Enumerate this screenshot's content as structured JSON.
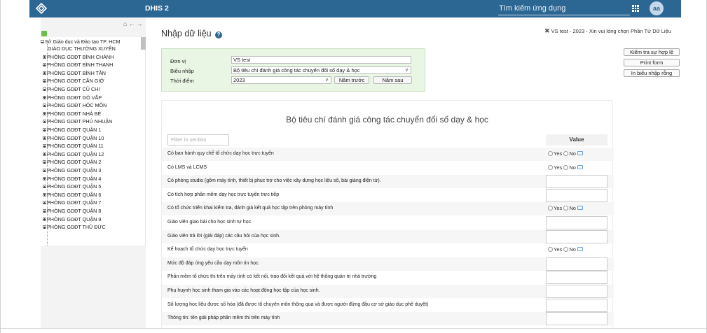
{
  "header": {
    "app_name": "DHIS 2",
    "search_placeholder": "Tìm kiếm ứng dụng",
    "avatar_initials": "aa",
    "bg_color": "#2c6693"
  },
  "tree": {
    "root": "Sở Giáo dục và Đào tạo TP. HCM",
    "items": [
      "GIÁO DỤC THƯỜNG XUYÊN",
      "PHÒNG GDĐT BÌNH CHÁNH",
      "PHÒNG GDĐT BÌNH THẠNH",
      "PHÒNG GDĐT BÌNH TÂN",
      "PHÒNG GDĐT CẦN GIỜ",
      "PHÒNG GDĐT CỦ CHI",
      "PHÒNG GDĐT GÒ VẤP",
      "PHÒNG GDĐT HÓC MÔN",
      "PHÒNG GDĐT NHÀ BÈ",
      "PHÒNG GDĐT PHÚ NHUẬN",
      "PHÒNG GDĐT QUẬN 1",
      "PHÒNG GDĐT QUẬN 10",
      "PHÒNG GDĐT QUẬN 11",
      "PHÒNG GDĐT QUẬN 12",
      "PHÒNG GDĐT QUẬN 2",
      "PHÒNG GDĐT QUẬN 3",
      "PHÒNG GDĐT QUẬN 4",
      "PHÒNG GDĐT QUẬN 5",
      "PHÒNG GDĐT QUẬN 6",
      "PHÒNG GDĐT QUẬN 7",
      "PHÒNG GDĐT QUẬN 8",
      "PHÒNG GDĐT QUẬN 9",
      "PHÒNG GDĐT THỦ ĐỨC"
    ]
  },
  "main": {
    "title": "Nhập dữ liệu",
    "notice": "VS test - 2023 - Xin vui lòng chọn Phần Tử Dữ Liệu",
    "buttons": {
      "validate": "Kiểm tra sự hợp lệ",
      "print_form": "Print form",
      "print_blank": "In biểu nhập rỗng"
    },
    "selection": {
      "org_unit_label": "Đơn vị",
      "org_unit_value": "VS test",
      "dataset_label": "Biểu nhập",
      "dataset_value": "Bộ tiêu chí đánh giá công tác chuyển đổi số dạy & học",
      "period_label": "Thời điểm",
      "period_value": "2023",
      "prev_year": "Năm trước",
      "next_year": "Năm sau"
    },
    "form": {
      "title": "Bộ tiêu chí đánh giá công tác chuyển đổi số dạy & học",
      "filter_placeholder": "Filter in section",
      "value_header": "Value",
      "yes_label": "Yes",
      "no_label": "No",
      "questions": [
        {
          "text": "Có ban hành quy chế tổ chức dạy học trực tuyến",
          "type": "yesno"
        },
        {
          "text": "Có LMS và LCMS",
          "type": "yesno"
        },
        {
          "text": "Có phòng studio (gồm máy tính, thiết bị phục trợ cho việc xây dựng học liệu số, bài giảng điện tử).",
          "type": "text"
        },
        {
          "text": "Có tích hợp phần mềm dạy học trực tuyến trực tiếp",
          "type": "text"
        },
        {
          "text": "Có tổ chức triển khai kiểm tra, đánh giá kết quả học tập trên phòng máy tính",
          "type": "yesno"
        },
        {
          "text": "Giáo viên giao bài cho học sinh tự học.",
          "type": "text"
        },
        {
          "text": "Giáo viên trả lời (giải đáp) các câu hỏi của học sinh.",
          "type": "text"
        },
        {
          "text": "Kế hoạch tổ chức dạy học trực tuyến",
          "type": "yesno"
        },
        {
          "text": "Mức độ đáp ứng yêu cầu dạy môn tin học.",
          "type": "text"
        },
        {
          "text": "Phần mềm tổ chức thi trên máy tính có kết nối, trao đổi kết quả với hệ thống quản trị nhà trường",
          "type": "text"
        },
        {
          "text": "Phụ huynh học sinh tham gia vào các hoạt động học tập của học sinh.",
          "type": "text"
        },
        {
          "text": "Số lượng học liệu được số hóa (đã được tổ chuyên môn thông qua và được người đứng đầu cơ sở giáo dục phê duyệt)",
          "type": "text"
        },
        {
          "text": "Thông tin: tên giải pháp phần mềm thi trên máy tính",
          "type": "text"
        }
      ]
    }
  }
}
